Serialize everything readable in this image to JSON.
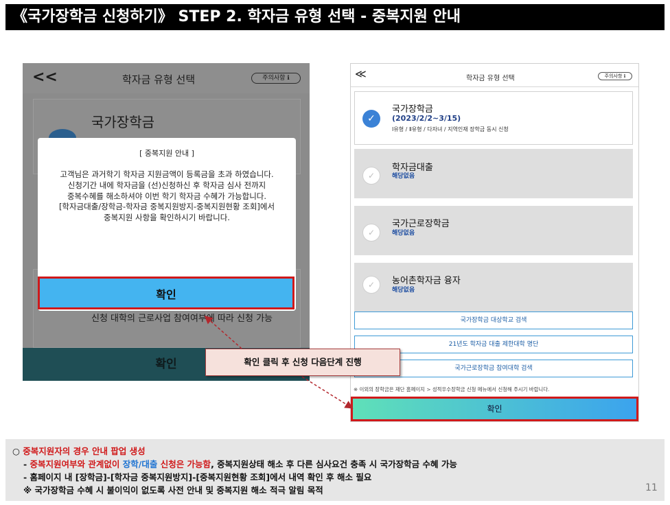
{
  "title": "《국가장학금 신청하기》 STEP 2. 학자금 유형 선택 - 중복지원 안내",
  "left_phone": {
    "back": "<<",
    "header_title": "학자금 유형 선택",
    "notice_label": "주의사항 ℹ",
    "card1_title": "국가장학금",
    "bottom_card_text": "신청 대학의 근로사업 참여여부에 따라 신청 가능",
    "confirm_label": "확인",
    "modal": {
      "title": "[ 중복지원 안내 ]",
      "lines": [
        "고객님은 과거학기 학자금 지원금액이 등록금을 초과 하였습니다.",
        "신청기간 내에 학자금을 (선)신청하신 후 학자금 심사 전까지",
        "중복수혜를 해소하셔야 이번 학기 학자금 수혜가 가능합니다.",
        "[학자금대출/장학금-학자금 중복지원방지-중복지원현황 조회]에서",
        "중복지원 사항을 확인하시기 바랍니다."
      ],
      "button_label": "확인"
    }
  },
  "right_phone": {
    "back": "≪",
    "header_title": "학자금 유형 선택",
    "notice_label": "주의사항 ℹ",
    "active_card": {
      "title": "국가장학금",
      "date": "(2023/2/2~3/15)",
      "sub": "Ⅰ유형 / Ⅱ유형 / 다자녀 / 지역인재 장학금 동시 신청",
      "check": "✓"
    },
    "cards": [
      {
        "title": "학자금대출",
        "sub": "해당없음"
      },
      {
        "title": "국가근로장학금",
        "sub": "해당없음"
      },
      {
        "title": "농어촌학자금 융자",
        "sub": "해당없음"
      }
    ],
    "links": [
      "국가장학금 대상학교 검색",
      "21년도 학자금 대출 제한대학 명단",
      "국가근로장학금 참여대학 검색"
    ],
    "footnote": "※ 이외의 장학금은 재단 홈페이지 > 성적우수장학금 신청 메뉴에서 신청해 주시기 바랍니다.",
    "confirm_label": "확인"
  },
  "callout": "확인 클릭 후 신청 다음단계 진행",
  "notes": {
    "line1_prefix": "○ ",
    "line1_red": "중복지원자의 경우 안내 팝업 생성",
    "line2_prefix": "- ",
    "line2_red1": "중복지원여부와 관계없이 ",
    "line2_blue": "장학/대출",
    "line2_red2": " 신청은 가능함",
    "line2_rest": ", 중복지원상태 해소 후 다른 심사요건 충족 시 국가장학금 수혜 가능",
    "line3": "- 홈페이지 내 [장학금]-[학자금 중복지원방지]-[중복지원현황 조회]에서 내역 확인 후 해소 필요",
    "line4": "※ 국가장학금 수혜 시 불이익이 없도록 사전 안내 및 중복지원 해소 적극 알림 목적"
  },
  "page_number": "11",
  "colors": {
    "accent_red": "#d0191a",
    "modal_button": "#44b4f0",
    "title_bar": "#000000"
  }
}
